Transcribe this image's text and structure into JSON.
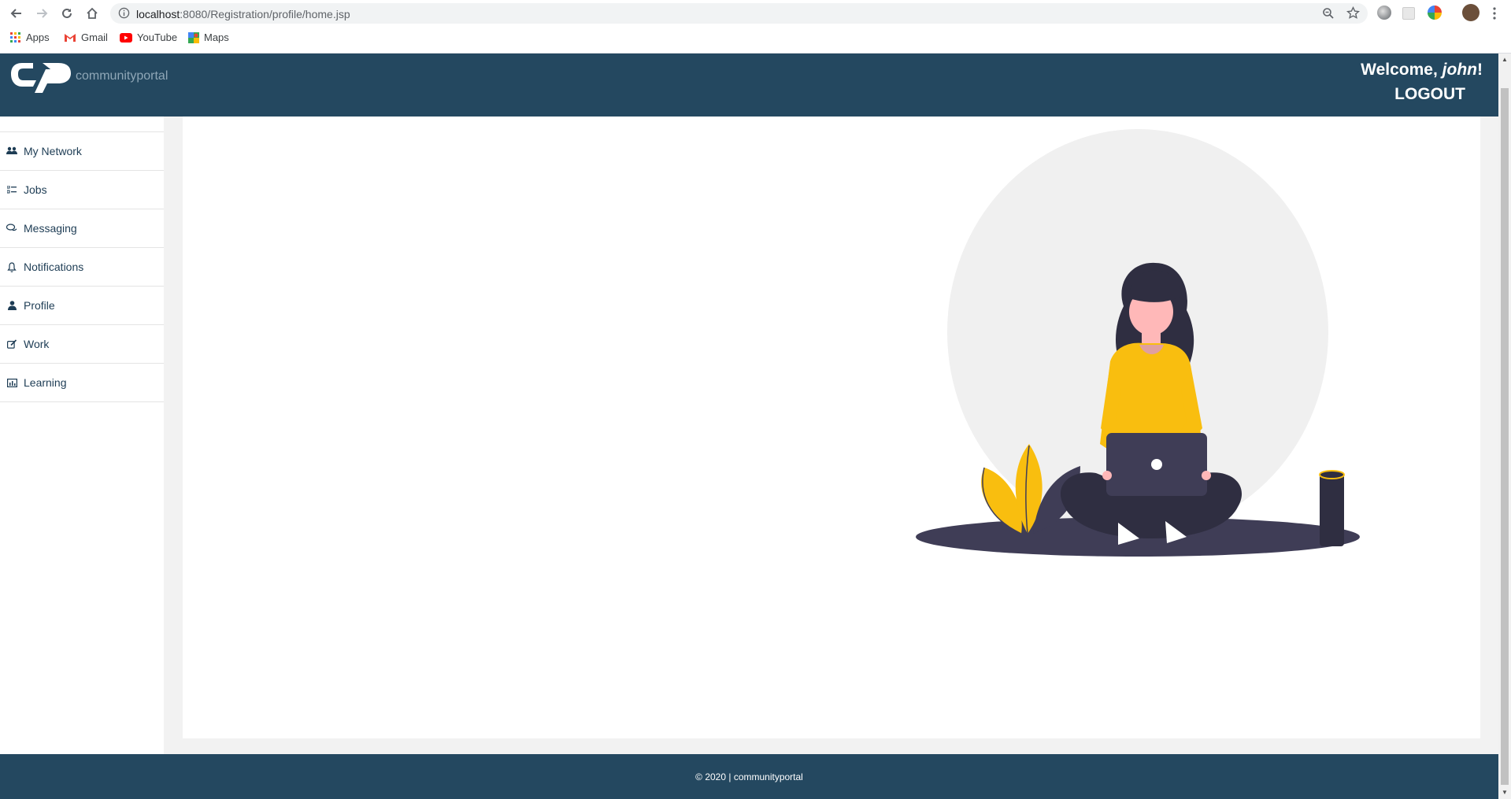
{
  "browser": {
    "url_host": "localhost",
    "url_path": ":8080/Registration/profile/home.jsp",
    "bookmarks": [
      "Apps",
      "Gmail",
      "YouTube",
      "Maps"
    ]
  },
  "header": {
    "brand": "communityportal",
    "welcome_prefix": "Welcome,",
    "username": "john",
    "welcome_suffix": "!",
    "logout": "LOGOUT"
  },
  "sidebar": {
    "items": [
      {
        "label": "My Network",
        "icon": "users-icon"
      },
      {
        "label": "Jobs",
        "icon": "list-icon"
      },
      {
        "label": "Messaging",
        "icon": "comments-icon"
      },
      {
        "label": "Notifications",
        "icon": "bell-icon"
      },
      {
        "label": "Profile",
        "icon": "user-icon"
      },
      {
        "label": "Work",
        "icon": "edit-icon"
      },
      {
        "label": "Learning",
        "icon": "chart-icon"
      }
    ]
  },
  "footer": {
    "text": "© 2020 | communityportal"
  },
  "colors": {
    "header_bg": "#244860",
    "accent_yellow": "#f9be0f",
    "dark_figure": "#3a3846"
  }
}
